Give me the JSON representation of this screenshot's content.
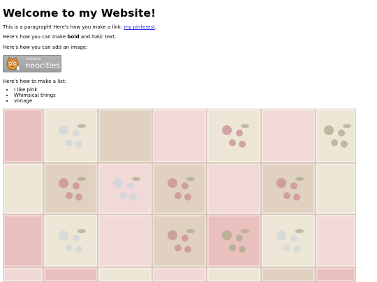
{
  "heading": "Welcome to my Website!",
  "paragraph1": {
    "before_link": "This is a paragraph! Here's how you make a link: ",
    "link_text": "my pinterest",
    "after_link": "."
  },
  "paragraph2": {
    "before_bold": "Here's how you can make ",
    "bold_text": "bold",
    "middle": " and ",
    "italic_text": "italic",
    "after": " text."
  },
  "paragraph3": "Here's how you can add an image:",
  "badge": {
    "small_text": "hosted by",
    "brand_text": "neocities"
  },
  "paragraph4": "Here's how to make a list:",
  "list_items": [
    "I like pink",
    "Whimsical things",
    "vintage"
  ],
  "quilt_colors": {
    "pink": "#e9c0bd",
    "cream": "#ede6d6",
    "blush": "#f0d9d6",
    "beige": "#e0d1c0",
    "flower_rose": "#c98c93",
    "flower_blue": "#cdd5dc",
    "leaf": "#a9ab8b"
  }
}
